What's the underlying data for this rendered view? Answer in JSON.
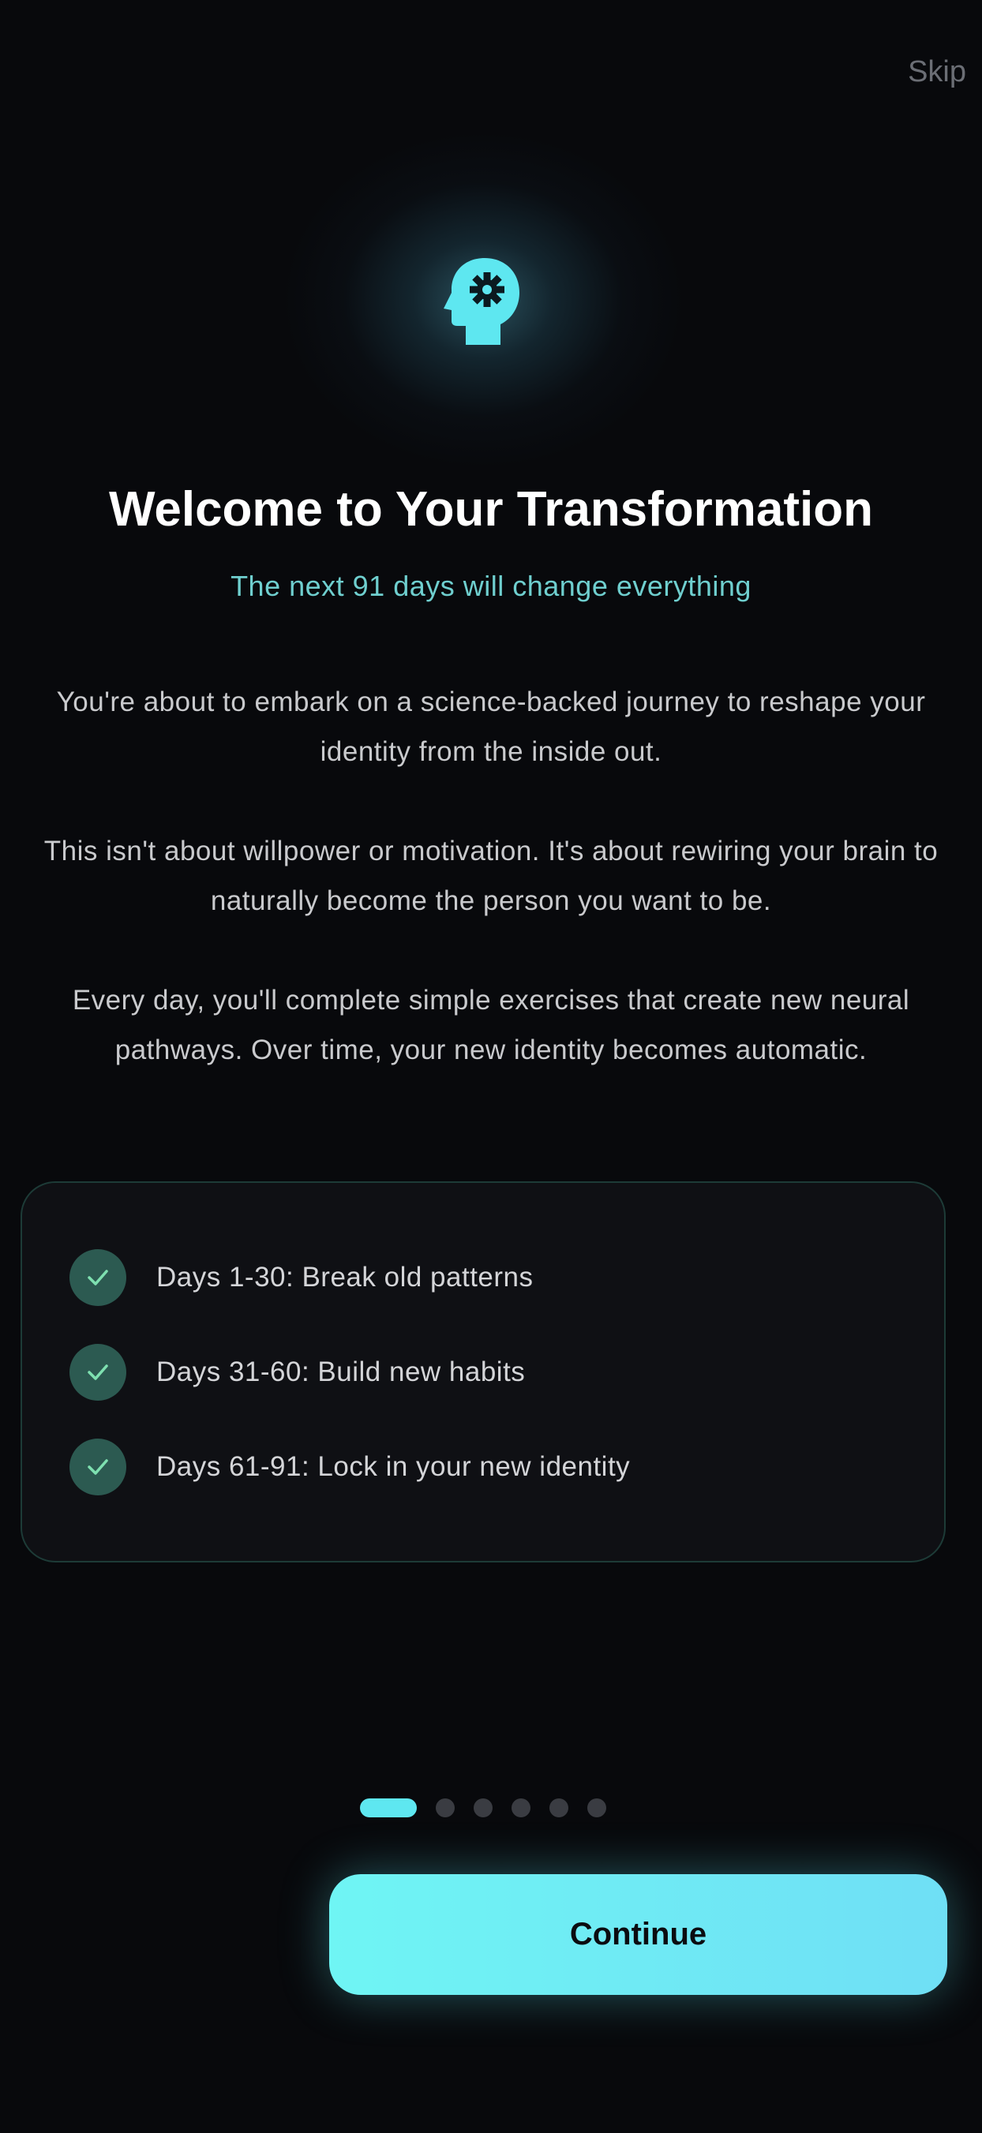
{
  "header": {
    "skip_label": "Skip"
  },
  "hero": {
    "icon": "head-gear-icon",
    "accent_color": "#5ee7f0"
  },
  "intro": {
    "title": "Welcome to Your Transformation",
    "subtitle": "The next 91 days will change everything",
    "paragraphs": [
      "You're about to embark on a science-backed journey to reshape your identity from the inside out.",
      "This isn't about willpower or motivation. It's about rewiring your brain to naturally become the person you want to be.",
      "Every day, you'll complete simple exercises that create new neural pathways. Over time, your new identity becomes automatic."
    ]
  },
  "phases": [
    {
      "label": "Days 1-30: Break old patterns",
      "icon": "check-icon"
    },
    {
      "label": "Days 31-60: Build new habits",
      "icon": "check-icon"
    },
    {
      "label": "Days 61-91: Lock in your new identity",
      "icon": "check-icon"
    }
  ],
  "pagination": {
    "total": 6,
    "current": 1
  },
  "footer": {
    "continue_label": "Continue"
  },
  "colors": {
    "background": "#08090c",
    "accent": "#5ee7f0",
    "subtitle": "#6fcfcf",
    "check_bg": "#2c5a51",
    "check_mark": "#7ee0b0"
  }
}
